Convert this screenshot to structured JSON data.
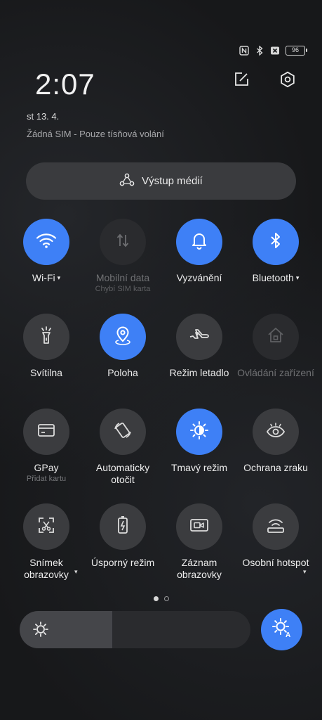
{
  "status_bar": {
    "icons": [
      "nfc-icon",
      "bluetooth-icon",
      "no-sim-icon"
    ],
    "battery": "96"
  },
  "header": {
    "time": "2:07",
    "date": "st 13. 4.",
    "sim_status": "Žádná SIM - Pouze tísňová volání"
  },
  "media_output": {
    "label": "Výstup médií"
  },
  "colors": {
    "accent": "#3e80f6",
    "tile_off": "#3b3c3f",
    "background": "#18191b"
  },
  "tiles": [
    {
      "label": "Wi-Fi",
      "sub": "",
      "icon": "wifi-icon",
      "state": "on",
      "caret": "▾"
    },
    {
      "label": "Mobilní data",
      "sub": "Chybí SIM karta",
      "icon": "mobile-data-icon",
      "state": "disabled",
      "caret": ""
    },
    {
      "label": "Vyzvánění",
      "sub": "",
      "icon": "bell-icon",
      "state": "on",
      "caret": ""
    },
    {
      "label": "Bluetooth",
      "sub": "",
      "icon": "bluetooth-icon",
      "state": "on",
      "caret": "▾"
    },
    {
      "label": "Svítilna",
      "sub": "",
      "icon": "flashlight-icon",
      "state": "off",
      "caret": ""
    },
    {
      "label": "Poloha",
      "sub": "",
      "icon": "location-icon",
      "state": "on",
      "caret": ""
    },
    {
      "label": "Režim letadlo",
      "sub": "",
      "icon": "airplane-icon",
      "state": "off",
      "caret": ""
    },
    {
      "label": "Ovládání zařízení",
      "sub": "",
      "icon": "home-icon",
      "state": "disabled",
      "caret": ""
    },
    {
      "label": "GPay",
      "sub": "Přidat kartu",
      "icon": "card-icon",
      "state": "off",
      "caret": ""
    },
    {
      "label": "Automaticky otočit",
      "sub": "",
      "icon": "rotate-icon",
      "state": "off",
      "caret": ""
    },
    {
      "label": "Tmavý režim",
      "sub": "",
      "icon": "dark-mode-icon",
      "state": "on",
      "caret": ""
    },
    {
      "label": "Ochrana zraku",
      "sub": "",
      "icon": "eye-icon",
      "state": "off",
      "caret": ""
    },
    {
      "label": "Snímek obrazovky",
      "sub": "",
      "icon": "screenshot-icon",
      "state": "off",
      "caret": "▾"
    },
    {
      "label": "Úsporný režim",
      "sub": "",
      "icon": "battery-saver-icon",
      "state": "off",
      "caret": ""
    },
    {
      "label": "Záznam obrazovky",
      "sub": "",
      "icon": "screen-record-icon",
      "state": "off",
      "caret": ""
    },
    {
      "label": "Osobní hotspot",
      "sub": "",
      "icon": "hotspot-icon",
      "state": "off",
      "caret": "▾"
    }
  ],
  "pager": {
    "pages": 2,
    "current": 1
  },
  "brightness": {
    "level": 0.4,
    "auto": true
  }
}
